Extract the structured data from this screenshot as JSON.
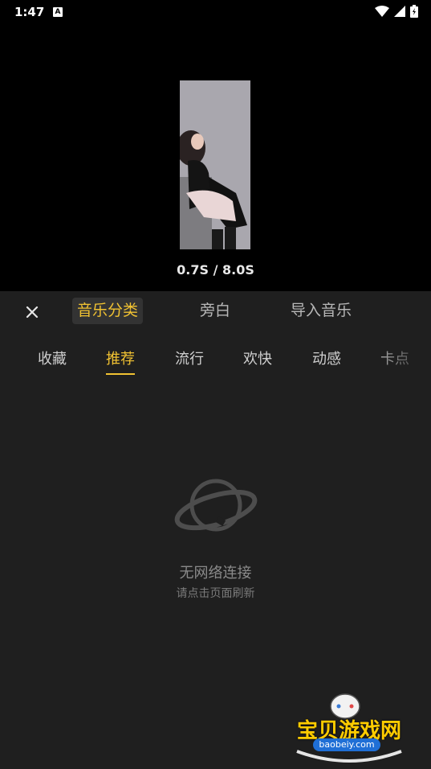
{
  "status_bar": {
    "time": "1:47",
    "a_badge": "A"
  },
  "preview": {
    "time_text": "0.7S / 8.0S"
  },
  "panel": {
    "top_tabs": [
      {
        "label": "音乐分类"
      },
      {
        "label": "旁白"
      },
      {
        "label": "导入音乐"
      }
    ],
    "categories": [
      {
        "label": "收藏"
      },
      {
        "label": "推荐"
      },
      {
        "label": "流行"
      },
      {
        "label": "欢快"
      },
      {
        "label": "动感"
      },
      {
        "label": "卡点"
      }
    ],
    "empty_state": {
      "title": "无网络连接",
      "subtitle": "请点击页面刷新",
      "icon": "planet-icon"
    }
  },
  "watermark": {
    "title": "宝贝游戏网",
    "domain": "baobeiy.com"
  },
  "colors": {
    "accent": "#f1c232",
    "panel_bg": "#1f1f1f"
  }
}
